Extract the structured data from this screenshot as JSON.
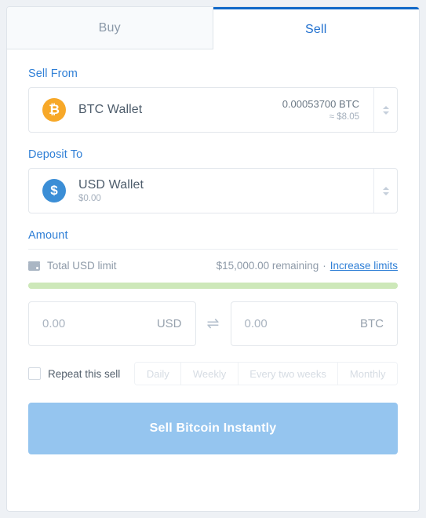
{
  "tabs": [
    {
      "label": "Buy",
      "active": false
    },
    {
      "label": "Sell",
      "active": true
    }
  ],
  "sell_from": {
    "section_label": "Sell From",
    "icon": "bitcoin-icon",
    "wallet_name": "BTC Wallet",
    "amount": "0.00053700 BTC",
    "fiat_equivalent": "≈ $8.05"
  },
  "deposit_to": {
    "section_label": "Deposit To",
    "icon": "dollar-icon",
    "wallet_name": "USD Wallet",
    "balance": "$0.00"
  },
  "amount": {
    "section_label": "Amount",
    "limit_icon": "wallet-icon",
    "limit_label": "Total USD limit",
    "limit_remaining": "$15,000.00 remaining",
    "limit_separator": "·",
    "increase_limits_link": "Increase limits",
    "progress_percent": 100,
    "fiat_input": {
      "value": "",
      "placeholder": "0.00",
      "unit": "USD"
    },
    "crypto_input": {
      "value": "",
      "placeholder": "0.00",
      "unit": "BTC"
    },
    "swap_icon": "⇌"
  },
  "repeat": {
    "checkbox_label": "Repeat this sell",
    "checked": false,
    "frequencies": [
      "Daily",
      "Weekly",
      "Every two weeks",
      "Monthly"
    ]
  },
  "cta": {
    "label": "Sell Bitcoin Instantly"
  },
  "colors": {
    "accent_blue": "#2f7fd6",
    "active_tab_border": "#1068c8",
    "btc_orange": "#f7a828",
    "usd_blue": "#3b8ed6",
    "progress_green": "#cde8b9",
    "cta_blue": "#95c5ef"
  }
}
